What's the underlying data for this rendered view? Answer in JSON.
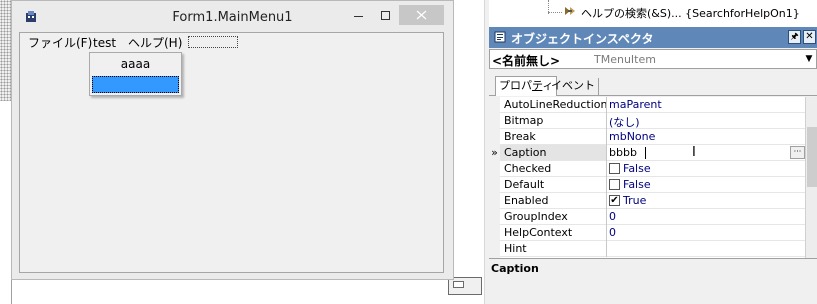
{
  "form": {
    "title": "Form1.MainMenu1",
    "window_buttons": {
      "minimize": "—",
      "maximize": "□",
      "close": "✕"
    },
    "menu": {
      "items": [
        "ファイル(F)",
        "test",
        "ヘルプ(H)"
      ],
      "dropdown": [
        "aaaa",
        ""
      ]
    }
  },
  "structure_tree": {
    "item": "ヘルプの検索(&S)... {SearchforHelpOn1}"
  },
  "inspector": {
    "title": "オブジェクトインスペクタ",
    "pin": "🖈",
    "close": "✕",
    "object_name": "<名前無し>",
    "object_type": "TMenuItem",
    "tabs": {
      "properties_pre": "プロパ",
      "properties_ul": "テ",
      "properties_post": "ィ",
      "events": "イベント"
    },
    "row_marker": "»",
    "ellipsis": "···",
    "ibeam": "I",
    "properties": [
      {
        "name": "AutoLineReduction",
        "value": "maParent"
      },
      {
        "name": "Bitmap",
        "value": "(なし)"
      },
      {
        "name": "Break",
        "value": "mbNone"
      },
      {
        "name": "Caption",
        "value": "bbbb"
      },
      {
        "name": "Checked",
        "value": "False",
        "checked": false
      },
      {
        "name": "Default",
        "value": "False",
        "checked": false
      },
      {
        "name": "Enabled",
        "value": "True",
        "checked": true
      },
      {
        "name": "GroupIndex",
        "value": "0"
      },
      {
        "name": "HelpContext",
        "value": "0"
      },
      {
        "name": "Hint",
        "value": ""
      }
    ],
    "description_title": "Caption"
  },
  "colors": {
    "inspector_titlebar": "#5f87b8",
    "selected_item": "#3399ff",
    "value_text": "#000080"
  }
}
